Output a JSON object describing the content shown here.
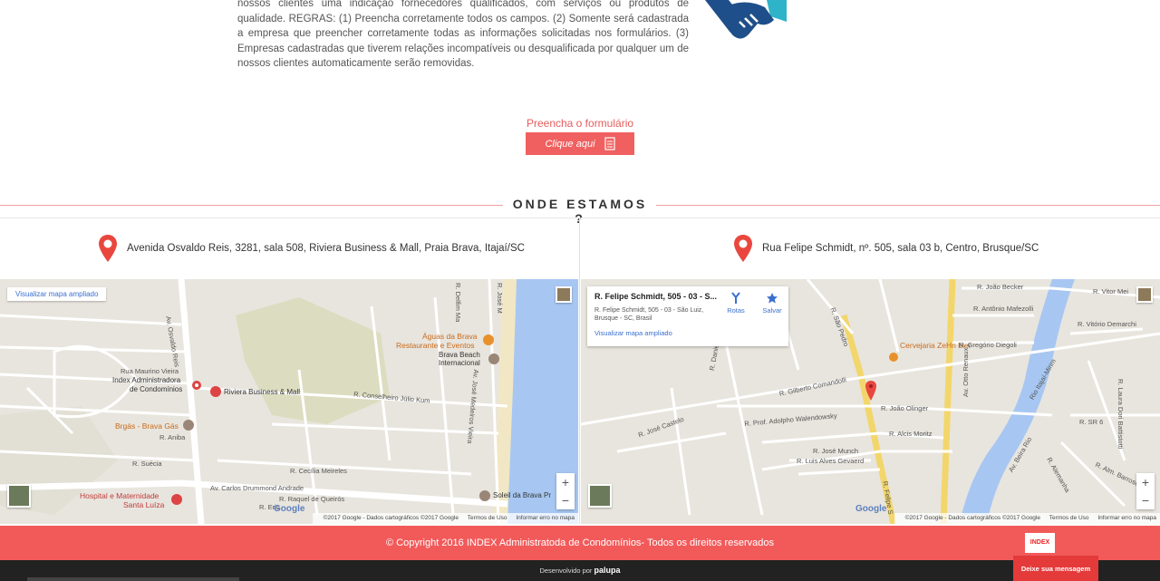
{
  "intro": {
    "paragraph": "nossos clientes uma indicação fornecedores qualificados, com serviços ou produtos de qualidade. REGRAS: (1) Preencha corretamente todos os campos. (2) Somente será cadastrada a empresa que preencher corretamente todas as informações solicitadas nos formulários. (3) Empresas cadastradas que tiverem relações incompatíveis ou desqualificada por qualquer um de nossos clientes automaticamente serão removidas."
  },
  "cta": {
    "label": "Preencha o formulário",
    "button": "Clique aqui"
  },
  "section": {
    "title": "ONDE ESTAMOS ?"
  },
  "locations": [
    {
      "address": "Avenida Osvaldo Reis, 3281, sala 508, Riviera Business & Mall, Praia Brava, Itajaí/SC"
    },
    {
      "address": "Rua Felipe Schmidt, nº. 505, sala 03 b, Centro, Brusque/SC"
    }
  ],
  "map1": {
    "view_larger": "Visualizar mapa ampliado",
    "labels": {
      "aguas": "Águas da Brava",
      "restaurante": "Restaurante e Eventos",
      "brava_beach": "Brava Beach",
      "internacional": "Internacional",
      "rua_maurino": "Rua Maurino Vieira",
      "index": "Index Administradora",
      "condominios": "de Condomínios",
      "riviera": "Riviera Business & Mall",
      "brgas": "Brgás - Brava Gás",
      "hospital": "Hospital e Maternidade",
      "santa_luiza": "Santa Luíza",
      "soleil": "Soleil da Brava Pr",
      "osvaldo": "Av. Osvaldo Reis",
      "delfim": "R. Delfim Ma",
      "jose_m": "R. José M",
      "conselheiro": "R. Conselheiro Júlio Kum",
      "jose_medeiros": "Av. José Medeiros Vieira",
      "aniba": "R. Aniba",
      "suecia": "R. Suécia",
      "cecilia": "R. Cecília Meireles",
      "carlos": "Av. Carlos Drummond Andrade",
      "raquel": "R. Raquel de Queirós",
      "eric": "R. Eric"
    },
    "attribution": "©2017 Google - Dados cartográficos ©2017 Google",
    "terms": "Termos de Uso",
    "report": "Informar erro no mapa",
    "logo": "Google"
  },
  "map2": {
    "card": {
      "title": "R. Felipe Schmidt, 505 - 03 - S...",
      "subtitle": "R. Felipe Schmidt, 505 - 03 - São Luiz, Brusque - SC, Brasil",
      "link": "Visualizar mapa ampliado",
      "routes": "Rotas",
      "save": "Salvar"
    },
    "labels": {
      "cervejaria": "Cervejaria ZeHn bier",
      "joao_becker": "R. João Becker",
      "vitor": "R. Vitor Mei",
      "antonio": "R. Antônio Mafezolli",
      "vitorio": "R. Vitório Demarchi",
      "gregorio": "R. Gregório Diegoli",
      "gilberto": "R. Gilberto Comandolli",
      "joao_olinger": "R. João Olinger",
      "adolpho": "R. Prof. Adolpho Walendowsky",
      "alcis": "R. Alcis Moritz",
      "jose_castelo": "R. José Castelo",
      "jose_munch": "R. José Munch",
      "luis": "R. Luis Alves Gevaerd",
      "otto": "Av. Otto Renaux",
      "itajai": "Rio Itajaí-Mirim",
      "beira_rio": "Av. Beira Rio",
      "laura": "R. Laura Dori Battistotti",
      "sr6": "R. SR 6",
      "barroso": "R. Alm. Barroso",
      "alemanha": "R. Alemanha",
      "felipe_s": "R. Felipe S",
      "daniel": "R. Daniel Imhof",
      "sao_pedro": "R. São Pedro"
    },
    "attribution": "©2017 Google - Dados cartográficos ©2017 Google",
    "terms": "Termos de Uso",
    "report": "Informar erro no mapa",
    "logo": "Google"
  },
  "footer": {
    "copyright": "© Copyright 2016 INDEX Administratoda de Condomínios- Todos os direitos reservados",
    "logo": "INDEX",
    "developed": "Desenvolvido por",
    "developer": "palupa",
    "message_button": "Deixe sua mensagem"
  },
  "colors": {
    "accent": "#f25a5a",
    "pin": "#e9473e",
    "water": "#a7c7f2",
    "text": "#333333"
  }
}
